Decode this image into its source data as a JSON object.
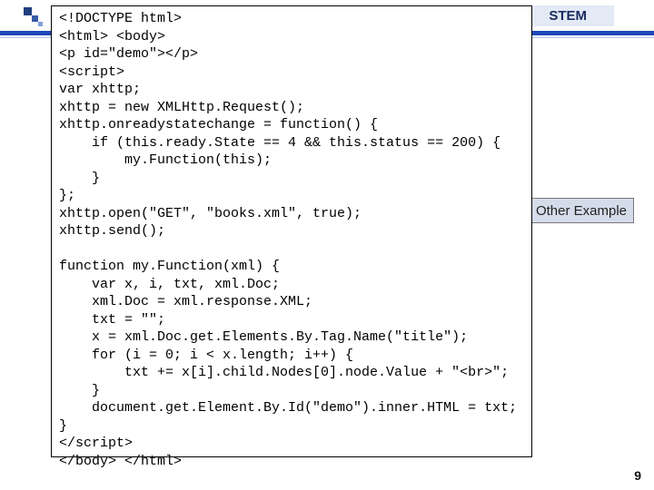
{
  "header": {
    "title": "STEM"
  },
  "callout": {
    "label": "Other Example"
  },
  "code": {
    "lines": [
      "<!DOCTYPE html>",
      "<html> <body>",
      "<p id=\"demo\"></p>",
      "<script>",
      "var xhttp;",
      "xhttp = new XMLHttp.Request();",
      "xhttp.onreadystatechange = function() {",
      "    if (this.ready.State == 4 && this.status == 200) {",
      "        my.Function(this);",
      "    }",
      "};",
      "xhttp.open(\"GET\", \"books.xml\", true);",
      "xhttp.send();",
      "",
      "function my.Function(xml) {",
      "    var x, i, txt, xml.Doc;",
      "    xml.Doc = xml.response.XML;",
      "    txt = \"\";",
      "    x = xml.Doc.get.Elements.By.Tag.Name(\"title\");",
      "    for (i = 0; i < x.length; i++) {",
      "        txt += x[i].child.Nodes[0].node.Value + \"<br>\";",
      "    }",
      "    document.get.Element.By.Id(\"demo\").inner.HTML = txt;",
      "}",
      "</script>",
      "</body> </html>"
    ]
  },
  "pagenum": "9"
}
